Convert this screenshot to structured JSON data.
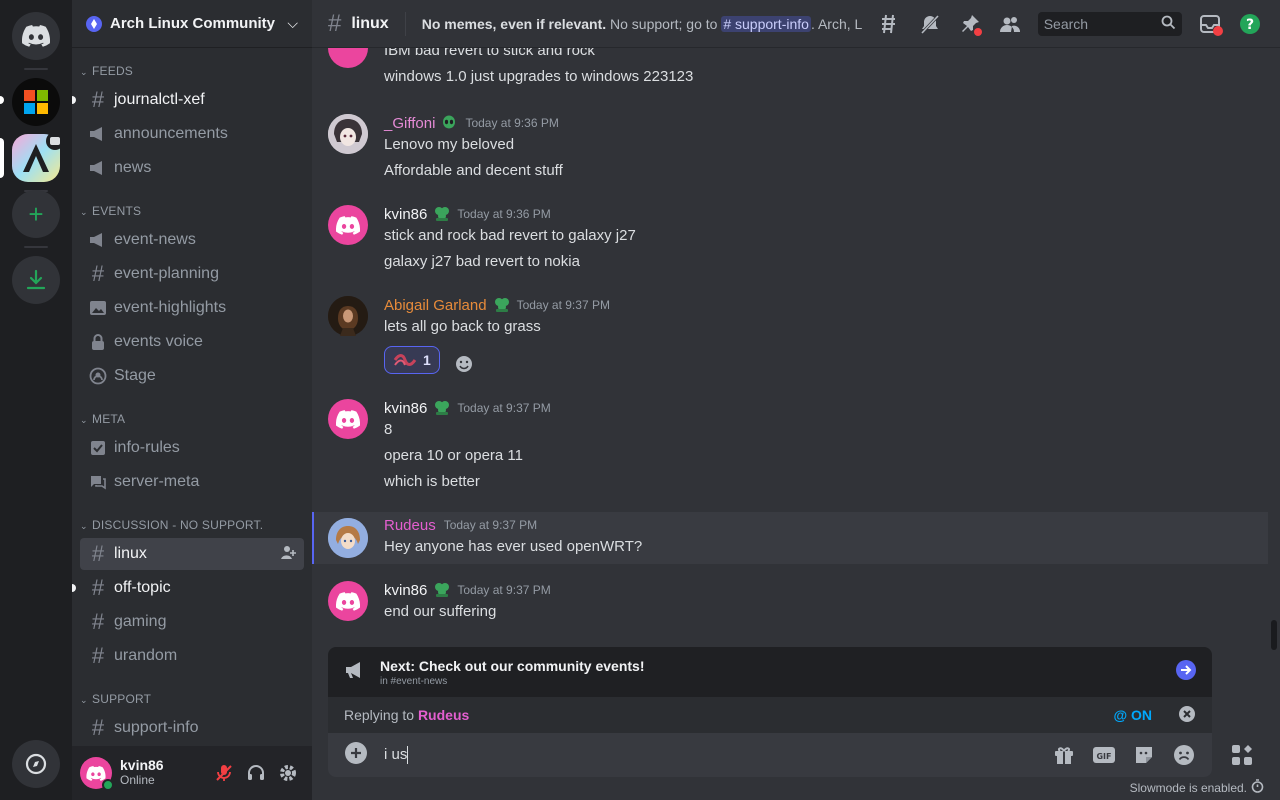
{
  "colors": {
    "accent": "#5865f2",
    "online": "#23a559",
    "discord_pink": "#eb459e",
    "abigail": "#e78b3a",
    "rudeus": "#e45fd0",
    "giffoni": "#e58bd6"
  },
  "rail": {
    "items": [
      "discord-home",
      "microsoft-server",
      "arch-server",
      "add-server",
      "download-apps",
      "discover"
    ]
  },
  "server": {
    "name": "Arch Linux Community"
  },
  "categories": [
    {
      "label": "FEEDS",
      "channels": [
        {
          "name": "journalctl-xef",
          "icon": "hash",
          "unread": true
        },
        {
          "name": "announcements",
          "icon": "megaphone"
        },
        {
          "name": "news",
          "icon": "megaphone"
        }
      ]
    },
    {
      "label": "EVENTS",
      "channels": [
        {
          "name": "event-news",
          "icon": "megaphone"
        },
        {
          "name": "event-planning",
          "icon": "hash"
        },
        {
          "name": "event-highlights",
          "icon": "image"
        },
        {
          "name": "events voice",
          "icon": "lock"
        },
        {
          "name": "Stage",
          "icon": "stage"
        }
      ]
    },
    {
      "label": "META",
      "channels": [
        {
          "name": "info-rules",
          "icon": "rules"
        },
        {
          "name": "server-meta",
          "icon": "forum"
        }
      ]
    },
    {
      "label": "DISCUSSION - NO SUPPORT.",
      "channels": [
        {
          "name": "linux",
          "icon": "hash",
          "active": true
        },
        {
          "name": "off-topic",
          "icon": "hash",
          "unread": true
        },
        {
          "name": "gaming",
          "icon": "hash"
        },
        {
          "name": "urandom",
          "icon": "hash"
        }
      ]
    },
    {
      "label": "SUPPORT",
      "channels": [
        {
          "name": "support-info",
          "icon": "hash"
        }
      ]
    }
  ],
  "user": {
    "name": "kvin86",
    "status": "Online"
  },
  "topbar": {
    "channel": "linux",
    "topic_bold": "No memes, even if relevant.",
    "topic_pre": " No support; go to ",
    "topic_chip": "support-info",
    "topic_post": ". Arch, Linux, BSD, ...",
    "search_placeholder": "Search"
  },
  "messages": [
    {
      "author": null,
      "lines": [
        "IBM bad revert to stick and rock",
        "windows 1.0 just upgrades to windows 223123"
      ]
    },
    {
      "author": "_Giffoni",
      "time": "Today at 9:36 PM",
      "lines": [
        "Lenovo my beloved",
        "Affordable and decent stuff"
      ]
    },
    {
      "author": "kvin86",
      "time": "Today at 9:36 PM",
      "lines": [
        "stick and rock bad revert to galaxy j27",
        "galaxy j27 bad revert to nokia"
      ]
    },
    {
      "author": "Abigail Garland",
      "time": "Today at 9:37 PM",
      "lines": [
        "lets all go back to grass"
      ],
      "reaction_count": "1"
    },
    {
      "author": "kvin86",
      "time": "Today at 9:37 PM",
      "lines": [
        "8",
        "opera 10 or opera 11",
        "which is better"
      ]
    },
    {
      "author": "Rudeus",
      "time": "Today at 9:37 PM",
      "lines": [
        "Hey anyone has ever used openWRT?"
      ]
    },
    {
      "author": "kvin86",
      "time": "Today at 9:37 PM",
      "lines": [
        "end our suffering"
      ]
    }
  ],
  "next_banner": {
    "title": "Next: Check out our community events!",
    "sub": "in #event-news"
  },
  "reply": {
    "prefix": "Replying to ",
    "name": "Rudeus",
    "mention": "@ ON"
  },
  "composer": {
    "value": "i us"
  },
  "slowmode": "Slowmode is enabled."
}
